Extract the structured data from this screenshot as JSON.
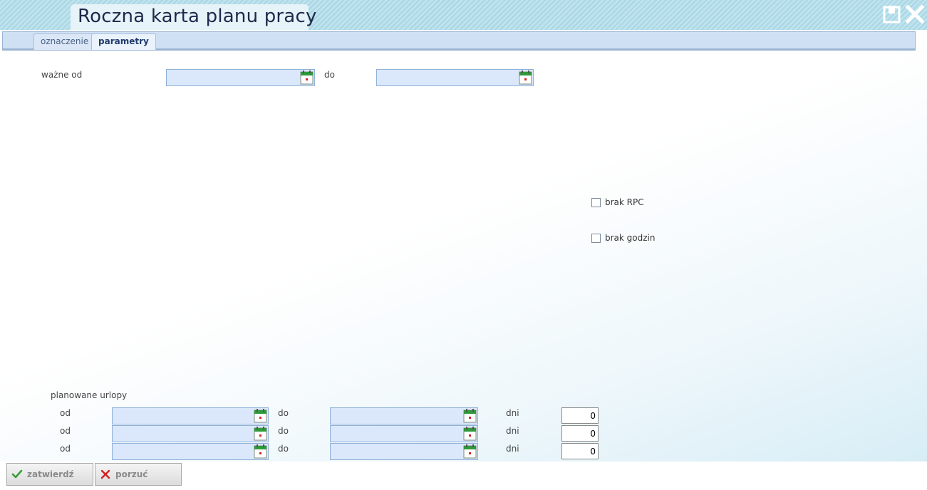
{
  "window": {
    "title": "Roczna karta planu pracy",
    "maximize_icon": "window-restore-icon",
    "close_icon": "close-x-icon"
  },
  "tabs": [
    {
      "label": "oznaczenie",
      "active": false
    },
    {
      "label": "parametry",
      "active": true
    }
  ],
  "validity": {
    "from_label": "ważne od",
    "from_value": "",
    "to_label": "do",
    "to_value": ""
  },
  "checkboxes": [
    {
      "label": "brak RPC",
      "checked": false
    },
    {
      "label": "brak godzin",
      "checked": false
    }
  ],
  "planned_leave": {
    "section_label": "planowane urlopy",
    "rows": [
      {
        "from_label": "od",
        "from_value": "",
        "to_label": "do",
        "to_value": "",
        "days_label": "dni",
        "days_value": "0"
      },
      {
        "from_label": "od",
        "from_value": "",
        "to_label": "do",
        "to_value": "",
        "days_label": "dni",
        "days_value": "0"
      },
      {
        "from_label": "od",
        "from_value": "",
        "to_label": "do",
        "to_value": "",
        "days_label": "dni",
        "days_value": "0"
      }
    ]
  },
  "buttons": {
    "confirm_label": "zatwierdź",
    "confirm_icon": "checkmark-icon",
    "cancel_label": "porzuć",
    "cancel_icon": "x-cross-icon"
  },
  "colors": {
    "header": "#a9d6e3",
    "field_bg": "#dbe8fb",
    "calendar_green": "#2e9a3a",
    "confirm_green": "#3a9a3a",
    "cancel_red": "#d42020"
  }
}
